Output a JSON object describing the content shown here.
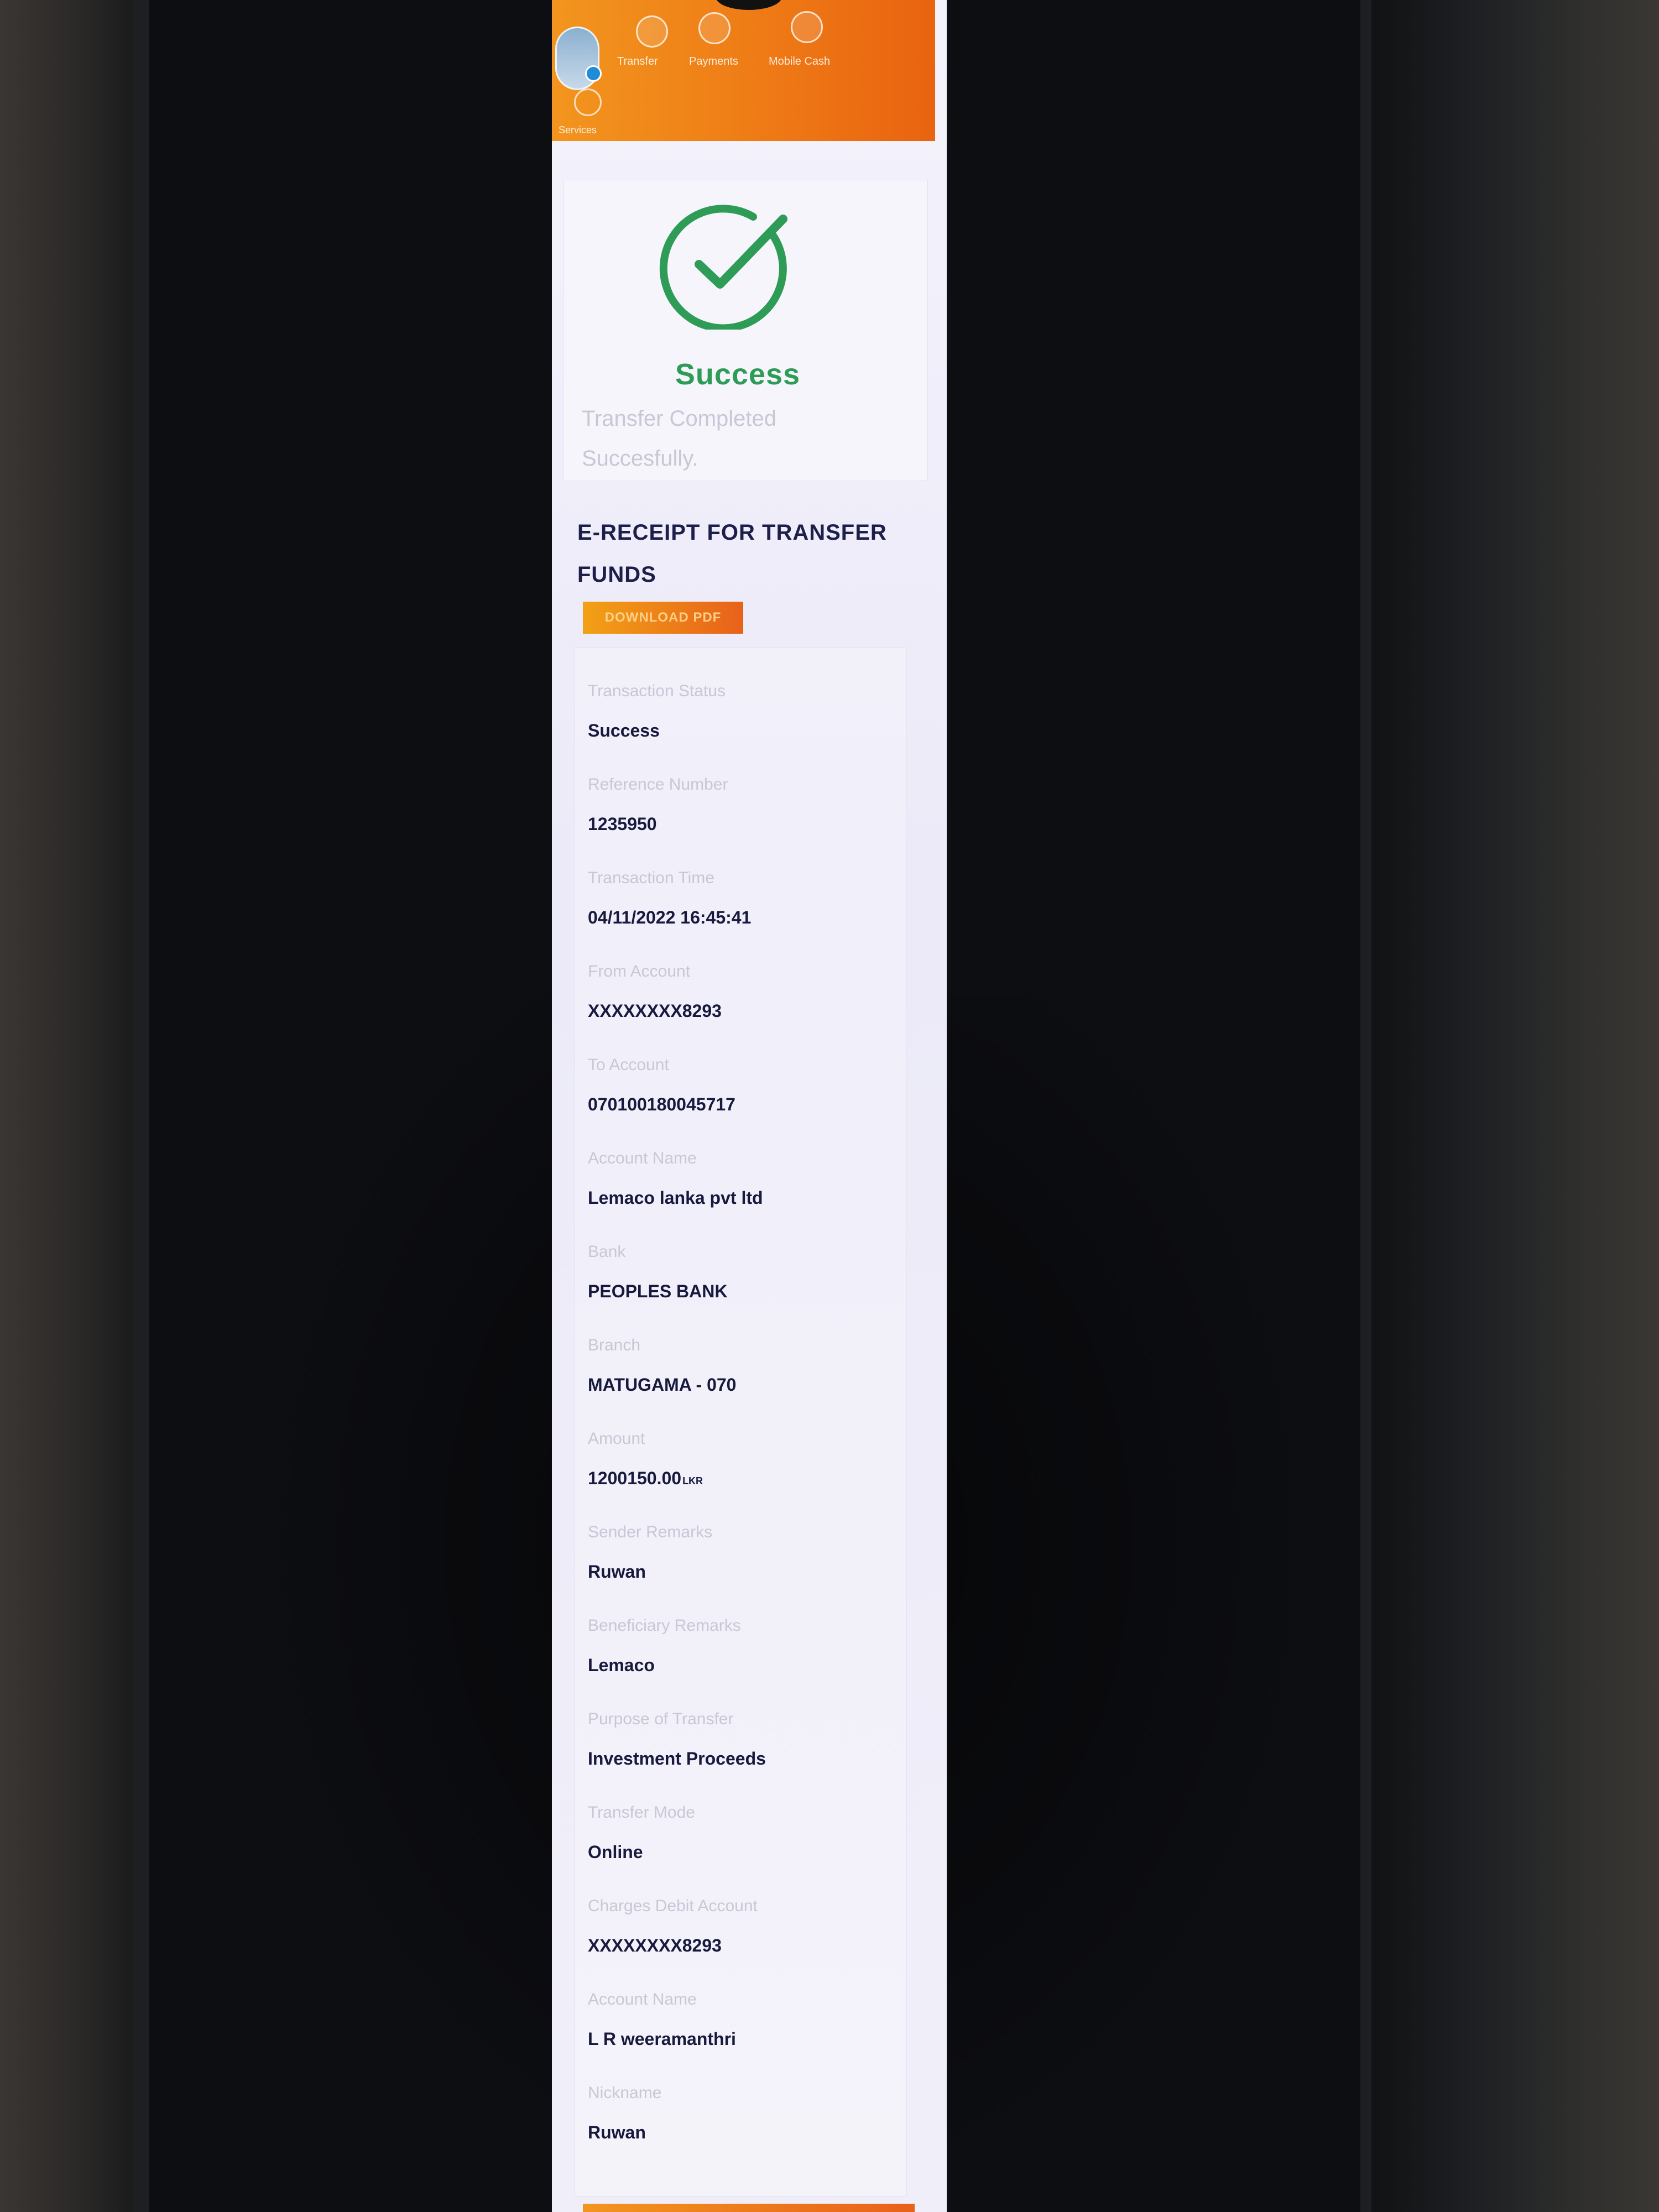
{
  "header": {
    "nav": [
      "Transfer",
      "Payments",
      "Mobile Cash"
    ],
    "section_label": "Services"
  },
  "success": {
    "title": "Success",
    "subtitle": "Transfer Completed Succesfully."
  },
  "receipt": {
    "title": "E-RECEIPT FOR TRANSFER FUNDS",
    "download_label": "DOWNLOAD PDF"
  },
  "details": [
    {
      "label": "Transaction Status",
      "value": "Success"
    },
    {
      "label": "Reference Number",
      "value": "1235950"
    },
    {
      "label": "Transaction Time",
      "value": "04/11/2022 16:45:41"
    },
    {
      "label": "From Account",
      "value": "XXXXXXXX8293"
    },
    {
      "label": "To Account",
      "value": "070100180045717"
    },
    {
      "label": "Account Name",
      "value": "Lemaco lanka pvt ltd"
    },
    {
      "label": "Bank",
      "value": "PEOPLES BANK"
    },
    {
      "label": "Branch",
      "value": "MATUGAMA - 070"
    },
    {
      "label": "Amount",
      "value": "1200150.00",
      "unit": "LKR"
    },
    {
      "label": "Sender Remarks",
      "value": "Ruwan"
    },
    {
      "label": "Beneficiary Remarks",
      "value": "Lemaco"
    },
    {
      "label": "Purpose of Transfer",
      "value": "Investment Proceeds"
    },
    {
      "label": "Transfer Mode",
      "value": "Online"
    },
    {
      "label": "Charges Debit Account",
      "value": "XXXXXXXX8293"
    },
    {
      "label": "Account Name",
      "value": "L R weeramanthri"
    },
    {
      "label": "Nickname",
      "value": "Ruwan"
    }
  ],
  "colors": {
    "accent_orange": "#ef7d16",
    "success_green": "#2e9c56",
    "text_dark": "#171a3d"
  }
}
